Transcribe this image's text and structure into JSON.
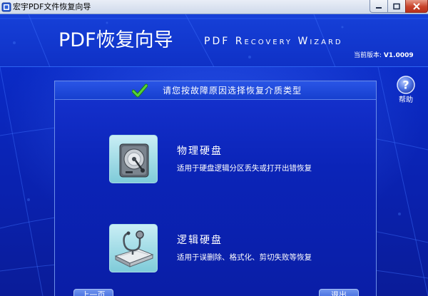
{
  "window": {
    "title": "宏宇PDF文件恢复向导"
  },
  "header": {
    "app_title": "PDF恢复向导",
    "app_subtitle": "PDF Recovery Wizard",
    "version_label": "当前版本:",
    "version_value": "V1.0009"
  },
  "help": {
    "label": "帮助",
    "icon": "question-icon"
  },
  "panel": {
    "title": "请您按故障原因选择恢复介质类型",
    "icon": "check-icon"
  },
  "options": [
    {
      "title": "物理硬盘",
      "description": "适用于硬盘逻辑分区丢失或打开出错恢复",
      "icon": "hard-disk-icon"
    },
    {
      "title": "逻辑硬盘",
      "description": "适用于误删除、格式化、剪切失败等恢复",
      "icon": "disk-stethoscope-icon"
    }
  ],
  "nav": {
    "prev_label": "上一页",
    "next_label": "退出"
  },
  "colors": {
    "background": "#0a22b0",
    "header": "#1640d8",
    "panel_border": "#6c8ee8",
    "check_green": "#3fbf2a"
  }
}
